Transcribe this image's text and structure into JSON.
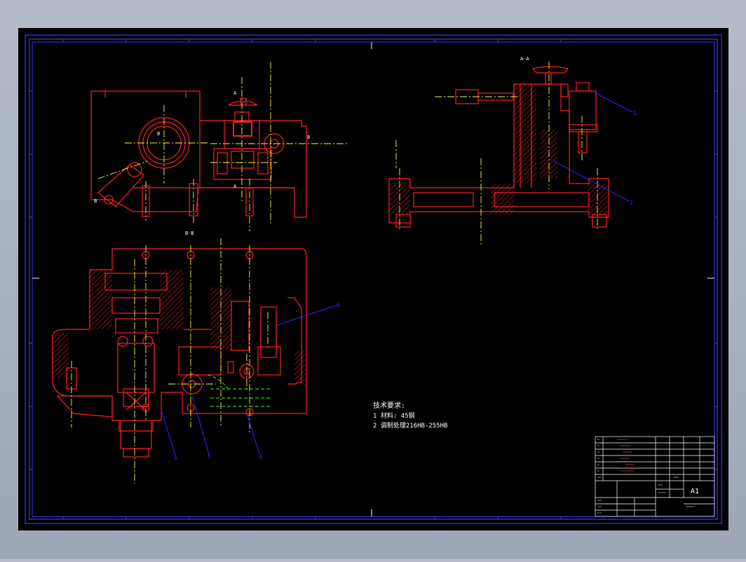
{
  "drawing": {
    "colors": {
      "viewer_bg": "#a9b1be",
      "sheet": "#000000",
      "border": "#3a3aff",
      "outline": "#ff2020",
      "centerline": "#ffff33",
      "leader": "#2a2aff",
      "hidden": "#30ff30",
      "text": "#ffffff"
    },
    "views": {
      "section_aa": "A-A",
      "section_bb": "B-B",
      "mark_a": "A",
      "mark_b": "B"
    },
    "balloons": [
      "1",
      "2",
      "3",
      "4",
      "5",
      "6"
    ],
    "tech_req": {
      "title": "技术要求:",
      "line1": "1 材料: 45钢",
      "line2": "2 调制处理216HB-255HB"
    },
    "title_block": {
      "sheet_size": "A1"
    }
  }
}
